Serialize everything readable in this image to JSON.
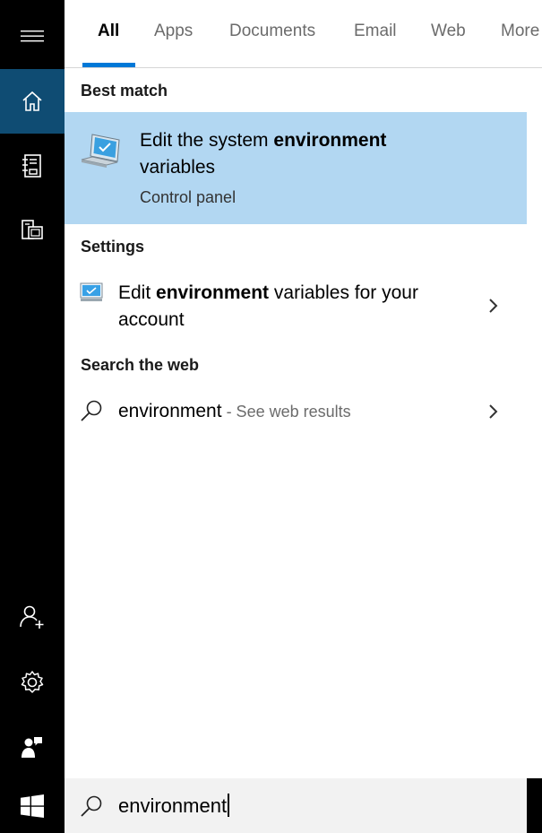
{
  "tabs": [
    "All",
    "Apps",
    "Documents",
    "Email",
    "Web",
    "More"
  ],
  "rail": {
    "items": [
      "hamburger-menu-icon",
      "home-icon",
      "notebook-icon",
      "devices-icon",
      "account-add-icon",
      "settings-icon",
      "feedback-icon"
    ]
  },
  "best_match": {
    "section": "Best match",
    "title_prefix": "Edit the system ",
    "title_bold": "environment",
    "title_suffix": "variables",
    "subtitle": "Control panel"
  },
  "settings": {
    "section": "Settings",
    "prefix": "Edit ",
    "bold": "environment",
    "suffix": " variables for your",
    "line2": "account"
  },
  "web": {
    "section": "Search the web",
    "query": "environment",
    "hint": " - See web results"
  },
  "search": {
    "value": "environment"
  },
  "colors": {
    "rail_active": "#0f4c73",
    "highlight": "#b2d7f2",
    "accent": "#0078d7"
  }
}
